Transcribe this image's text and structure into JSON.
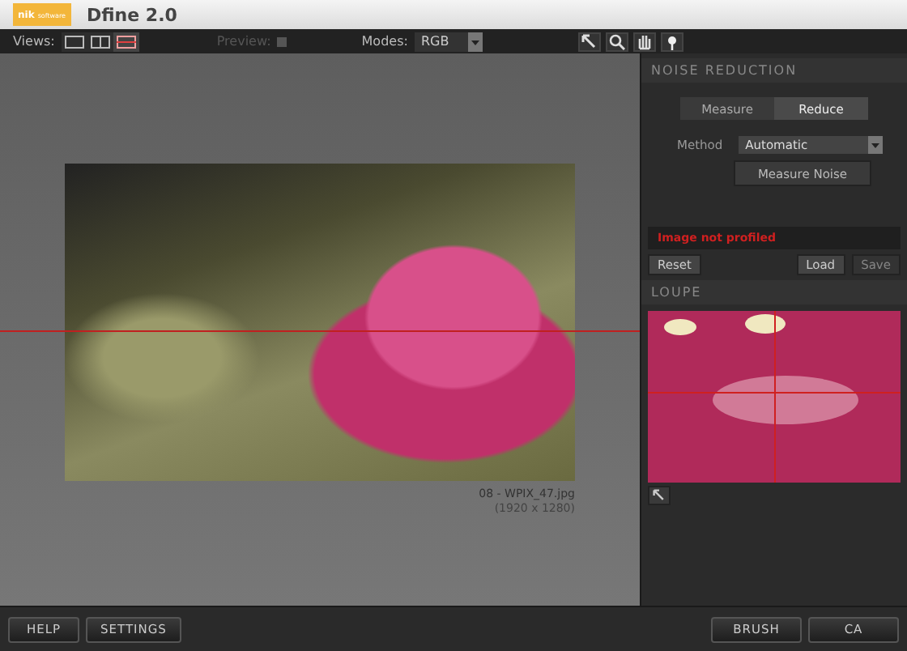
{
  "window": {
    "logo": "nik",
    "logo_sub": "software",
    "title": "Dfine 2.0"
  },
  "toolbar": {
    "views_label": "Views:",
    "views": [
      {
        "selected": false
      },
      {
        "selected": false
      },
      {
        "selected": true
      }
    ],
    "preview_label": "Preview:",
    "preview_disabled": true,
    "modes_label": "Modes:",
    "mode": "RGB"
  },
  "canvas": {
    "filename": "08 - WPIX_47.jpg",
    "dimensions": "(1920 x 1280)"
  },
  "noise_reduction": {
    "header": "NOISE REDUCTION",
    "tabs": [
      {
        "label": "Measure",
        "selected": false
      },
      {
        "label": "Reduce",
        "selected": true
      }
    ],
    "method_label": "Method",
    "method": "Automatic",
    "measure_button": "Measure Noise",
    "status": "Image not profiled",
    "buttons": [
      {
        "label": "Reset",
        "disabled": false
      },
      {
        "label": "Load",
        "disabled": false
      },
      {
        "label": "Save",
        "disabled": true
      }
    ]
  },
  "loupe": {
    "header": "LOUPE"
  },
  "footer": {
    "left_buttons": [
      "HELP",
      "SETTINGS"
    ],
    "right_buttons": [
      "BRUSH",
      "CA"
    ]
  }
}
